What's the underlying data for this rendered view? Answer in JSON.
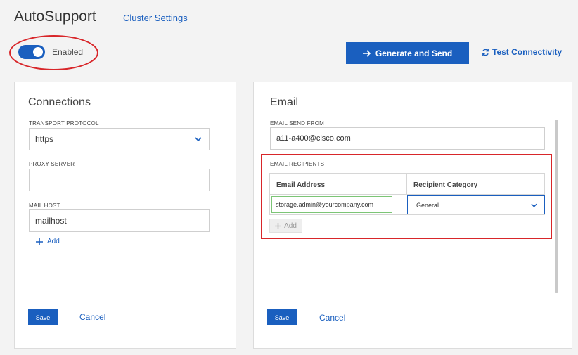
{
  "header": {
    "title": "AutoSupport",
    "cluster_settings_link": "Cluster Settings"
  },
  "toggle": {
    "label": "Enabled",
    "enabled": true
  },
  "actions": {
    "generate_and_send": "Generate and Send",
    "test_connectivity": "Test Connectivity"
  },
  "connections": {
    "title": "Connections",
    "transport_protocol_label": "TRANSPORT PROTOCOL",
    "transport_protocol_value": "https",
    "proxy_server_label": "PROXY SERVER",
    "proxy_server_value": "",
    "mail_host_label": "MAIL HOST",
    "mail_host_value": "mailhost",
    "add_label": "Add",
    "save_label": "Save",
    "cancel_label": "Cancel"
  },
  "email": {
    "title": "Email",
    "send_from_label": "EMAIL SEND FROM",
    "send_from_value": "a11-a400@cisco.com",
    "recipients_label": "EMAIL RECIPIENTS",
    "columns": [
      "Email Address",
      "Recipient Category"
    ],
    "rows": [
      {
        "email": "storage.admin@yourcompany.com",
        "category": "General"
      }
    ],
    "add_label": "Add",
    "save_label": "Save",
    "cancel_label": "Cancel"
  },
  "colors": {
    "accent": "#1a5fbf",
    "annotation": "#d8262a",
    "valid_field": "#7cc576"
  },
  "icons": {
    "generate": "arrow-right-icon",
    "test": "refresh-icon",
    "add": "plus-icon",
    "dropdown": "chevron-down-icon"
  }
}
